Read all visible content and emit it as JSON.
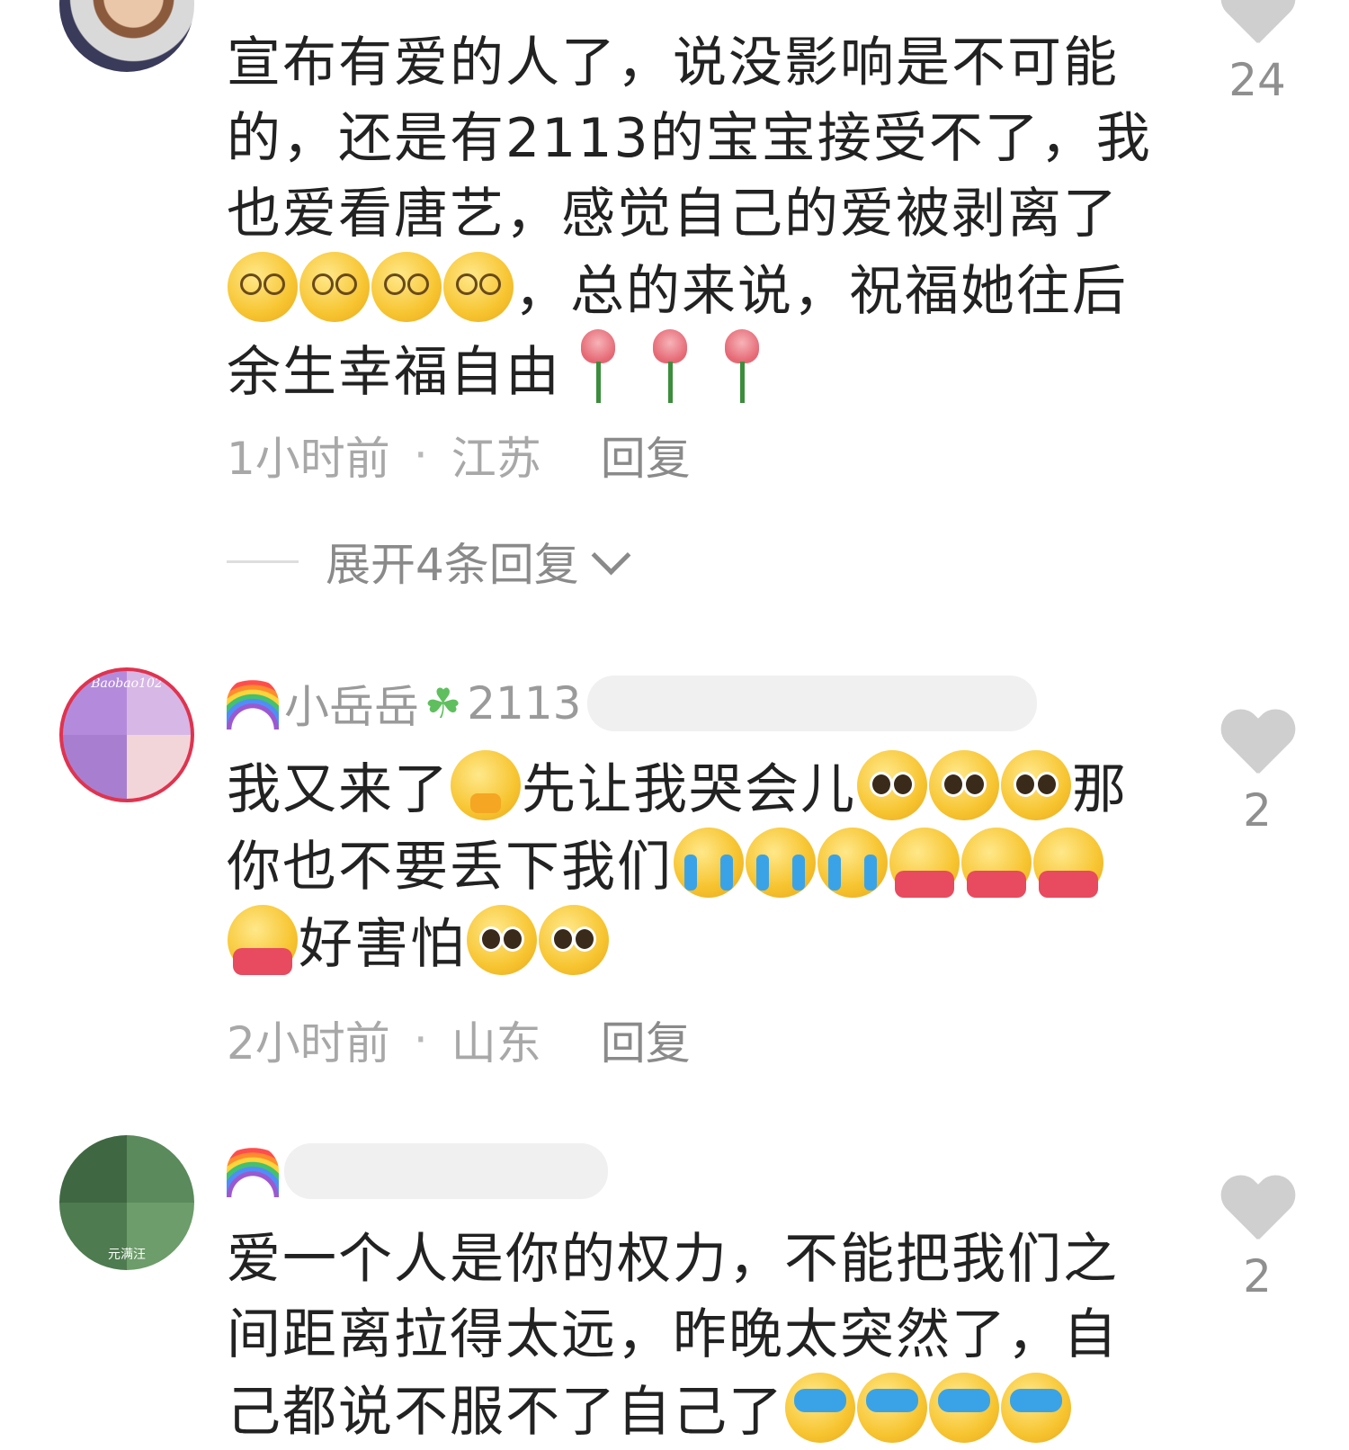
{
  "comments": [
    {
      "text_lines": [
        "宣布有爱的人了，说没影响是不可能",
        "的，还是有2113的宝宝接受不了，我",
        "也爱看唐艺，感觉自己的爱被剥离了",
        "，总的来说，祝福她往后",
        "余生幸福自由"
      ],
      "time": "1小时前",
      "location": "江苏",
      "reply_label": "回复",
      "expand_label": "展开4条回复",
      "likes": "24"
    },
    {
      "username_visible": "小岳岳",
      "username_suffix": "2113",
      "avatar_tag": "Baobao102",
      "text_parts": [
        "我又来了",
        "先让我哭会儿",
        "那",
        "你也不要丢下我们",
        "好害怕"
      ],
      "time": "2小时前",
      "location": "山东",
      "reply_label": "回复",
      "likes": "2"
    },
    {
      "avatar_tag": "元满汪",
      "text_lines": [
        "爱一个人是你的权力，不能把我们之",
        "间距离拉得太远，昨晚太突然了，自",
        "己都说不服不了自己了"
      ],
      "likes": "2"
    }
  ],
  "icons": {
    "like": "heart-icon",
    "expand": "chevron-down-icon",
    "rainbow": "rainbow-icon",
    "clover": "clover-icon"
  },
  "colors": {
    "text": "#222222",
    "meta": "#a8a8a8",
    "heart": "#cfcfcf"
  }
}
